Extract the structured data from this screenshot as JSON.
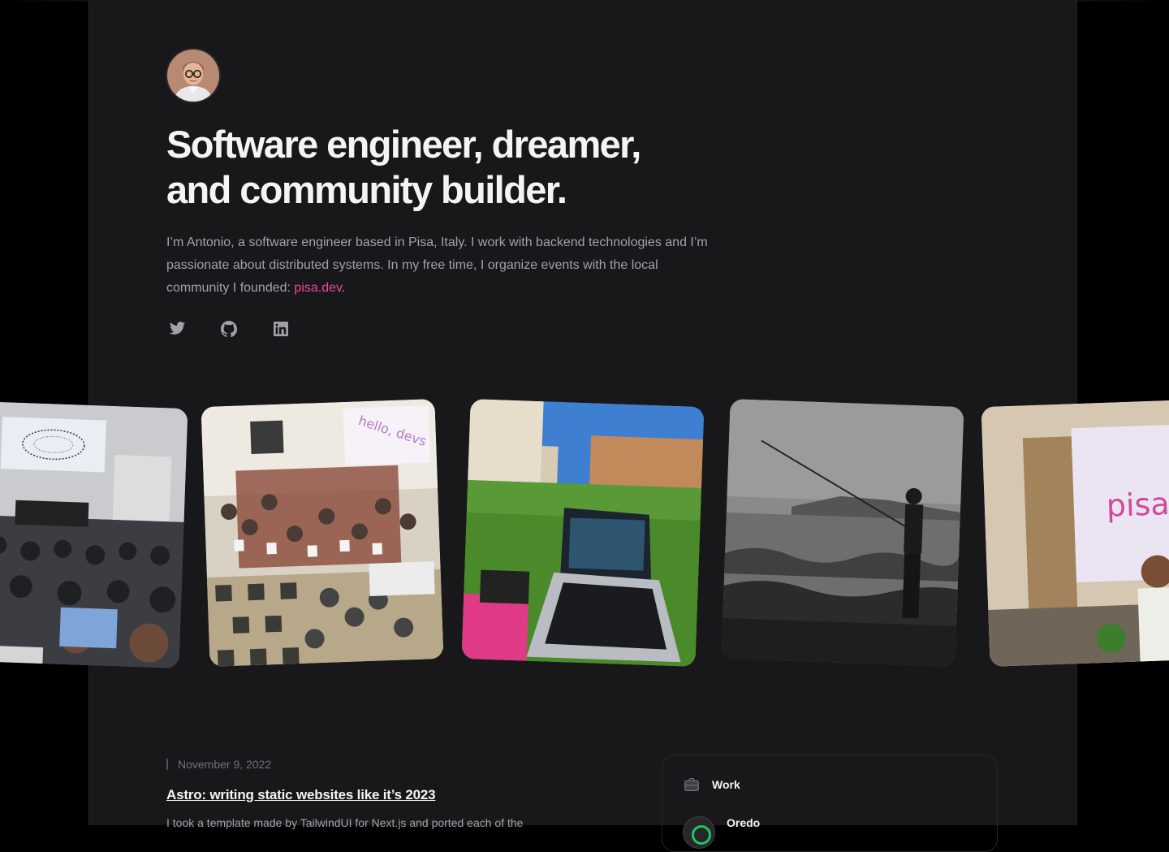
{
  "hero": {
    "headline_line1": "Software engineer, dreamer,",
    "headline_line2": "and community builder.",
    "intro_text": "I’m Antonio, a software engineer based in Pisa, Italy. I work with backend technologies and I’m passionate about distributed systems. In my free time, I organize events with the local community I founded: ",
    "intro_link": "pisa.dev",
    "intro_end": "."
  },
  "socials": [
    "twitter-icon",
    "github-icon",
    "linkedin-icon"
  ],
  "photos": {
    "slide2_text": "hello, devs",
    "slide5_text": "pisa.d"
  },
  "article": {
    "date": "November 9, 2022",
    "title": "Astro: writing static websites like it’s 2023",
    "excerpt": "I took a template made by TailwindUI for Next.js and ported each of the"
  },
  "work": {
    "label": "Work",
    "company": "Oredo"
  },
  "colors": {
    "background": "#000000",
    "panel": "#18181b",
    "accent": "#ec4899",
    "text": "#f4f4f5",
    "muted": "#a1a1aa"
  }
}
